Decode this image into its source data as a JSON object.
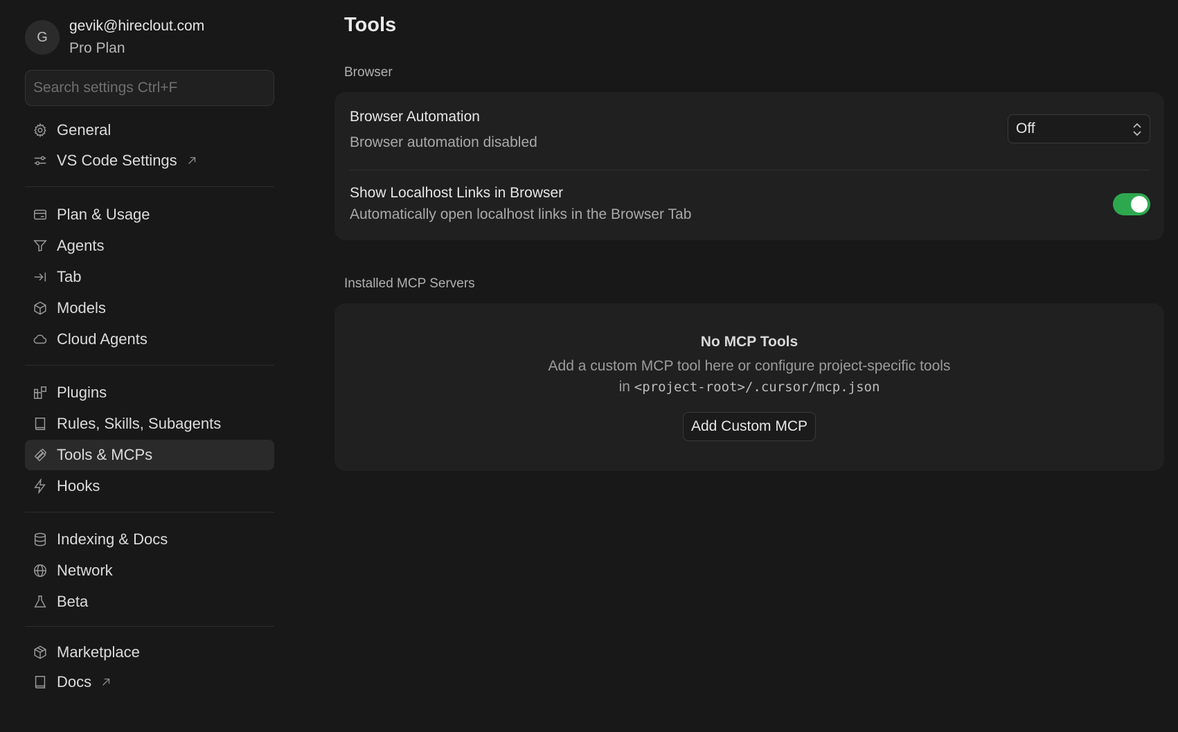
{
  "account": {
    "avatar_initial": "G",
    "email": "gevik@hireclout.com",
    "plan": "Pro Plan"
  },
  "search": {
    "placeholder": "Search settings Ctrl+F"
  },
  "sidebar": {
    "items": [
      {
        "label": "General",
        "icon": "gear-icon"
      },
      {
        "label": "VS Code Settings",
        "icon": "sliders-icon",
        "external": true
      },
      {
        "label": "Plan & Usage",
        "icon": "card-icon"
      },
      {
        "label": "Agents",
        "icon": "funnel-icon"
      },
      {
        "label": "Tab",
        "icon": "tab-arrow-icon"
      },
      {
        "label": "Models",
        "icon": "cube-icon"
      },
      {
        "label": "Cloud Agents",
        "icon": "cloud-icon"
      },
      {
        "label": "Plugins",
        "icon": "puzzle-icon"
      },
      {
        "label": "Rules, Skills, Subagents",
        "icon": "book-icon"
      },
      {
        "label": "Tools & MCPs",
        "icon": "tools-icon",
        "active": true
      },
      {
        "label": "Hooks",
        "icon": "bolt-icon"
      },
      {
        "label": "Indexing & Docs",
        "icon": "database-icon"
      },
      {
        "label": "Network",
        "icon": "globe-icon"
      },
      {
        "label": "Beta",
        "icon": "flask-icon"
      },
      {
        "label": "Marketplace",
        "icon": "package-icon"
      },
      {
        "label": "Docs",
        "icon": "book-icon",
        "external": true
      }
    ]
  },
  "main": {
    "title": "Tools",
    "browser_section": {
      "label": "Browser",
      "automation_title": "Browser Automation",
      "automation_desc": "Browser automation disabled",
      "automation_value": "Off",
      "localhost_title": "Show Localhost Links in Browser",
      "localhost_desc": "Automatically open localhost links in the Browser Tab",
      "localhost_enabled": true
    },
    "mcp_section": {
      "label": "Installed MCP Servers",
      "empty_title": "No MCP Tools",
      "empty_desc_line1": "Add a custom MCP tool here or configure project-specific tools",
      "empty_desc_prefix": "in",
      "empty_desc_path": "<project-root>/.cursor/mcp.json",
      "add_button": "Add Custom MCP"
    }
  },
  "colors": {
    "background": "#181818",
    "card": "#202020",
    "toggle_on": "#2ea84f",
    "active_nav": "#2a2a2a"
  }
}
